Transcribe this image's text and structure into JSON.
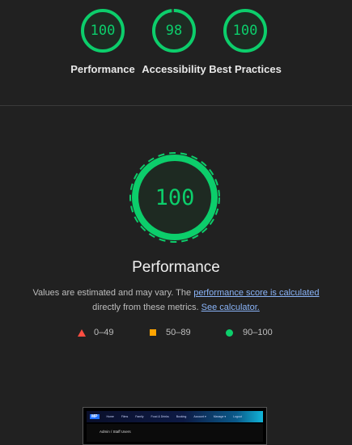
{
  "summary": {
    "gauges": [
      {
        "score": "100",
        "label": "Performance"
      },
      {
        "score": "98",
        "label": "Accessibility"
      },
      {
        "score": "100",
        "label": "Best Practices"
      }
    ]
  },
  "performance": {
    "score": "100",
    "title": "Performance",
    "desc_prefix": "Values are estimated and may vary. The ",
    "desc_link": "performance score is calculated",
    "desc_middle": " directly from these metrics. ",
    "desc_link2": "See calculator."
  },
  "legend": {
    "fail": "0–49",
    "average": "50–89",
    "pass": "90–100"
  },
  "colors": {
    "pass": "#0cce6b",
    "average": "#ffa400",
    "fail": "#ff4e42",
    "link": "#8ab4f8"
  },
  "thumbnail": {
    "logo": "MP",
    "nav_links": [
      "Home",
      "Films",
      "Family",
      "Food & Drinks",
      "Booking",
      "Account ▾",
      "Manage ▾",
      "Logout"
    ],
    "heading": "Admin / Staff Users"
  }
}
